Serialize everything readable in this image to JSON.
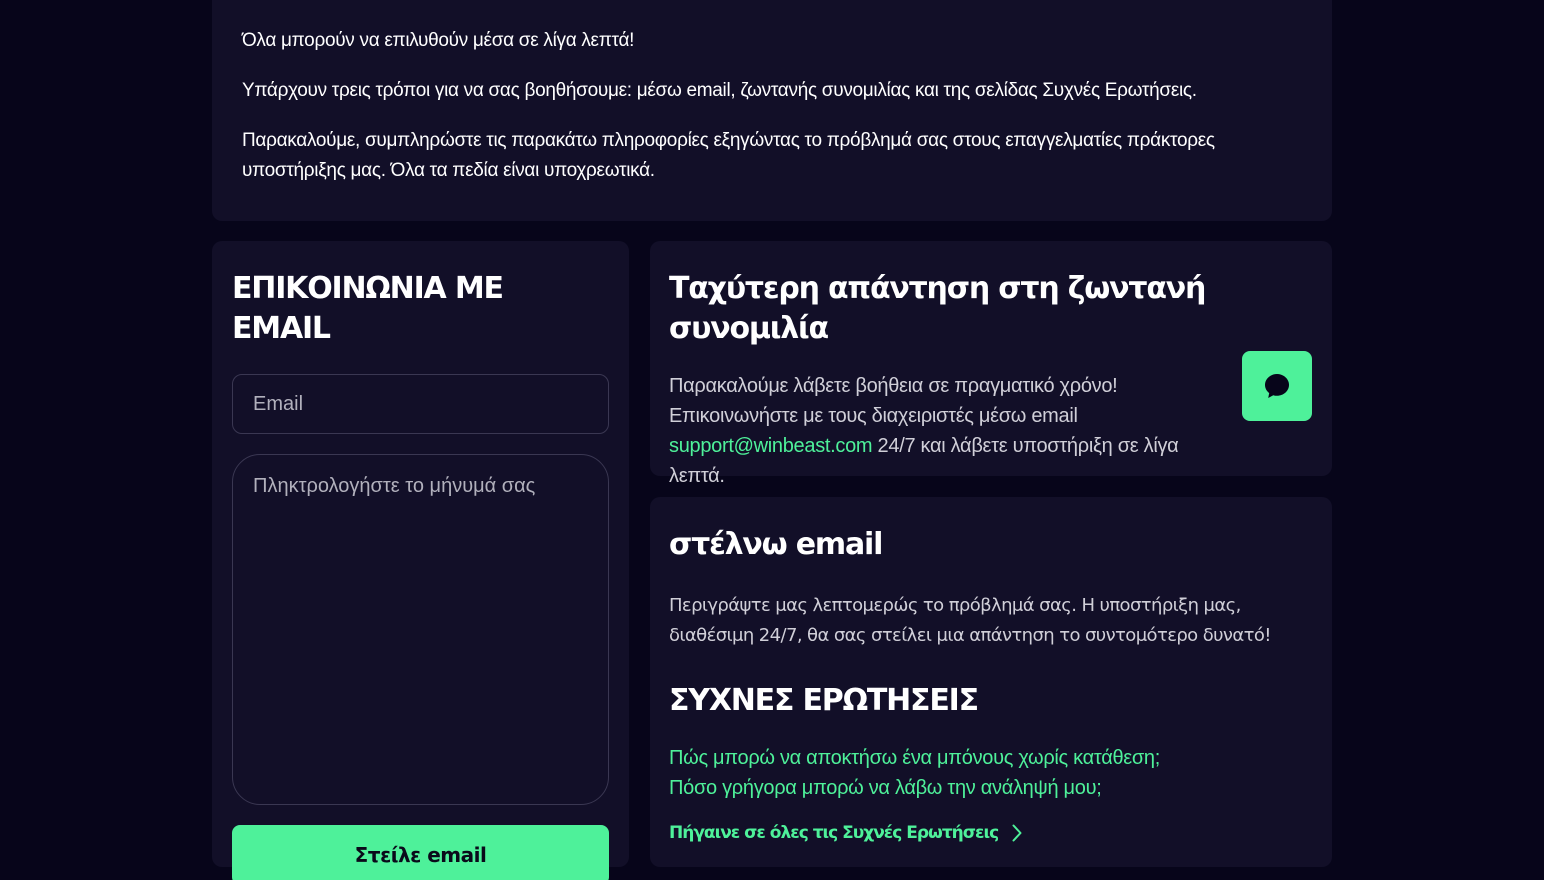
{
  "intro": {
    "line1": "Όλα μπορούν να επιλυθούν μέσα σε λίγα λεπτά!",
    "line2": "Υπάρχουν τρεις τρόποι για να σας βοηθήσουμε: μέσω email, ζωντανής συνομιλίας και της σελίδας Συχνές Ερωτήσεις.",
    "line3": "Παρακαλούμε, συμπληρώστε τις παρακάτω πληροφορίες εξηγώντας το πρόβλημά σας στους επαγγελματίες πράκτορες υποστήριξης μας. Όλα τα πεδία είναι υποχρεωτικά."
  },
  "email_form": {
    "title": "ΕΠΙΚΟΙΝΩΝΙΑ ΜΕ EMAIL",
    "email_placeholder": "Email",
    "email_value": "",
    "message_placeholder": "Πληκτρολογήστε το μήνυμά σας",
    "message_value": "",
    "submit_label": "Στείλε email"
  },
  "live_chat": {
    "title": "Ταχύτερη απάντηση στη ζωντανή συνομιλία",
    "text_before": "Παρακαλούμε λάβετε βοήθεια σε πραγματικό χρόνο! Επικοινωνήστε με τους διαχειριστές μέσω email ",
    "email": "support@winbeast.com",
    "text_after": " 24/7 και λάβετε υποστήριξη σε λίγα λεπτά.",
    "button_icon": "chat-bubble-icon"
  },
  "send_email": {
    "title": "στέλνω email",
    "description": "Περιγράψτε μας λεπτομερώς το πρόβλημά σας. Η υποστήριξη μας, διαθέσιμη 24/7, θα σας στείλει μια απάντηση το συντομότερο δυνατό!"
  },
  "faq": {
    "title": "ΣΥΧΝΕΣ ΕΡΩΤΗΣΕΙΣ",
    "items": [
      "Πώς μπορώ να αποκτήσω ένα μπόνους χωρίς κατάθεση;",
      "Πόσο γρήγορα μπορώ να λάβω την ανάληψή μου;"
    ],
    "all_link": "Πήγαινε σε όλες τις Συχνές Ερωτήσεις",
    "all_link_icon": "chevron-right-icon"
  },
  "colors": {
    "background": "#07051a",
    "panel": "#120f28",
    "accent": "#4ef19a",
    "text_muted": "#d0cfd8",
    "placeholder": "#b1b0bc",
    "border": "#3a3752"
  }
}
